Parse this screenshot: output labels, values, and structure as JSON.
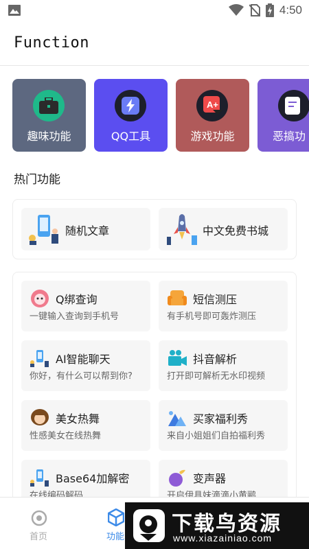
{
  "status_bar": {
    "time": "4:50",
    "icons": [
      "image-icon",
      "wifi-icon",
      "no-sim-icon",
      "battery-charging-icon"
    ]
  },
  "app_bar": {
    "title": "Function"
  },
  "categories": [
    {
      "label": "趣味功能",
      "icon": "briefcase-icon",
      "color": "#5d6880"
    },
    {
      "label": "QQ工具",
      "icon": "lightning-icon",
      "color": "#5b4ef0"
    },
    {
      "label": "游戏功能",
      "icon": "game-icon",
      "color": "#b05a5a"
    },
    {
      "label": "恶搞功",
      "icon": "note-icon",
      "color": "#7c5cd4"
    }
  ],
  "hot_section": {
    "title": "热门功能",
    "items": [
      {
        "label": "随机文章",
        "icon": "article-illustration"
      },
      {
        "label": "中文免费书城",
        "icon": "rocket-illustration"
      }
    ]
  },
  "features": [
    {
      "title": "Q绑查询",
      "desc": "一键输入查询到手机号",
      "icon": "pink-lion-icon"
    },
    {
      "title": "短信测压",
      "desc": "有手机号即可轰炸测压",
      "icon": "orange-sofa-icon"
    },
    {
      "title": "AI智能聊天",
      "desc": "你好，有什么可以帮到你?",
      "icon": "chat-illustration-icon"
    },
    {
      "title": "抖音解析",
      "desc": "打开即可解析无水印视频",
      "icon": "video-camera-icon"
    },
    {
      "title": "美女热舞",
      "desc": "性感美女在线热舞",
      "icon": "girl-avatar-icon"
    },
    {
      "title": "买家福利秀",
      "desc": "来自小姐姐们自拍福利秀",
      "icon": "mountain-icon"
    },
    {
      "title": "Base64加解密",
      "desc": "在线编码解码",
      "icon": "code-illustration-icon"
    },
    {
      "title": "变声器",
      "desc": "开启伊具妹滴滴小黄鹂",
      "icon": "eggplant-icon"
    }
  ],
  "bottom_nav": {
    "items": [
      {
        "label": "首页",
        "icon": "home-circle-icon",
        "active": false
      },
      {
        "label": "功能",
        "icon": "cube-icon",
        "active": true
      }
    ],
    "active_color": "#3d8be8",
    "inactive_color": "#aaaaaa"
  },
  "watermark": {
    "title": "下载鸟资源",
    "url": "www.xiazainiao.com"
  }
}
